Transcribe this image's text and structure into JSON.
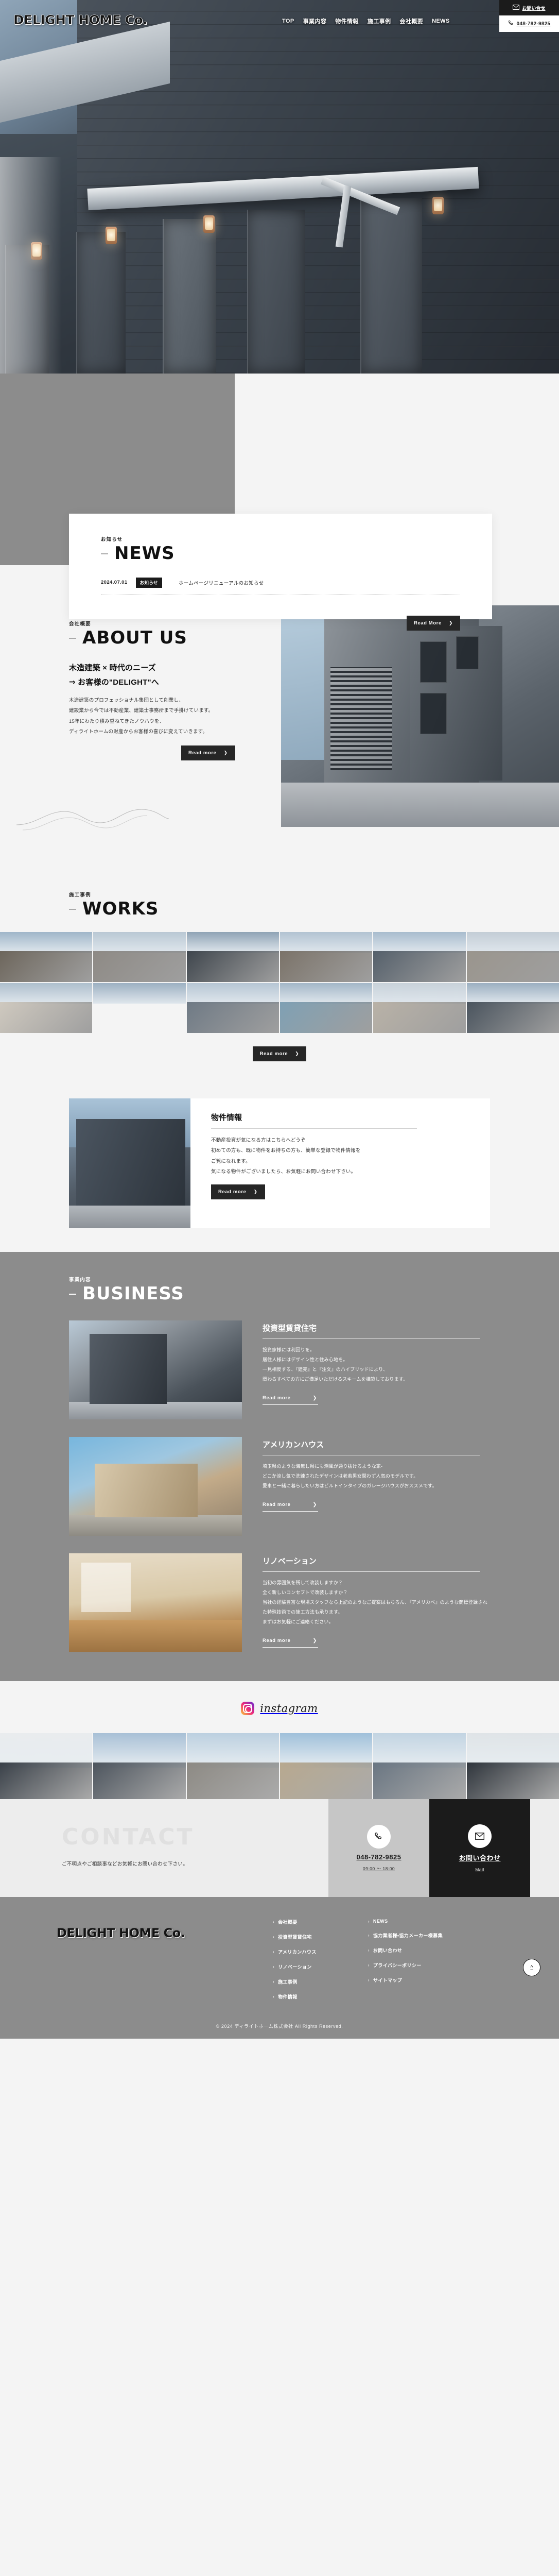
{
  "site": {
    "brand": "DELIGHT HOME Co.",
    "nav": [
      {
        "label": "TOP"
      },
      {
        "label": "事業内容"
      },
      {
        "label": "物件情報"
      },
      {
        "label": "施工事例"
      },
      {
        "label": "会社概要"
      },
      {
        "label": "NEWS"
      }
    ],
    "header_contact": {
      "mail_label": "お問い合せ",
      "mail_icon": "envelope-icon",
      "tel_label": "048-782-9825",
      "tel_icon": "phone-icon"
    }
  },
  "news": {
    "eyebrow": "お知らせ",
    "title": "NEWS",
    "items": [
      {
        "date": "2024.07.01",
        "tag": "お知らせ",
        "title": "ホームページリニューアルのお知らせ"
      }
    ],
    "button": "Read More"
  },
  "about": {
    "eyebrow": "会社概要",
    "title": "ABOUT US",
    "heading_line1": "木造建築 × 時代のニーズ",
    "heading_line2": "⇒ お客様の\"DELIGHT\"へ",
    "body": "木造建築のプロフェッショナル集団として創業し、\n建設業から今では不動産業、建築士事務所まで手掛けています。\n15年にわたり積み重ねてきたノウハウを、\nディライトホームの財産からお客様の喜びに変えていきます。",
    "button": "Read more"
  },
  "works": {
    "eyebrow": "施工事例",
    "title": "WORKS",
    "button": "Read more",
    "thumbnails": [
      {
        "sky": "#9fb6c9",
        "body": "#6d665c"
      },
      {
        "sky": "#b9c8d4",
        "body": "#8e8a85"
      },
      {
        "sky": "#8fa3b5",
        "body": "#3f464d"
      },
      {
        "sky": "#b2c3d2",
        "body": "#7b7369"
      },
      {
        "sky": "#a8bcce",
        "body": "#55606b"
      },
      {
        "sky": "#c3cdd6",
        "body": "#9a958d"
      },
      {
        "sky": "#aebfcd",
        "body": "#cfc9bf"
      },
      {
        "sky": "#9cb0c2",
        "body": "#8c8madd"
      },
      {
        "sky": "#b6c6d4",
        "body": "#6f7a85"
      },
      {
        "sky": "#a3b7c8",
        "body": "#7fa0b4"
      },
      {
        "sky": "#c8d2da",
        "body": "#b9b2a7"
      },
      {
        "sky": "#9bafc1",
        "body": "#4a545e"
      }
    ]
  },
  "property": {
    "title": "物件情報",
    "body": "不動産投資が気になる方はこちらへどうぞ\n初めての方も、既に物件をお持ちの方も、簡単な登録で物件情報を\nご覧になれます。\n気になる物件がございましたら、お気軽にお問い合わせ下さい。",
    "button": "Read more"
  },
  "business": {
    "eyebrow": "事業内容",
    "title": "BUSINESS",
    "items": [
      {
        "title": "投資型賃貸住宅",
        "body": "投資家様には利回りを。\n居住人様にはデザイン性と住み心地を。\n一見相反する、『建売』と『注文』のハイブリッドにより、\n関わるすべての方にご満足いただけるスキームを構築しております。",
        "button": "Read more"
      },
      {
        "title": "アメリカンハウス",
        "body": "埼玉県のような海無し県にも潮風が通り抜けるような家-\nどこか涼し気で洗練されたデザインは老若男女問わず人気のモデルです。\n愛車と一緒に暮らしたい方はビルトインタイプのガレージハウスがおススメです。",
        "button": "Read more"
      },
      {
        "title": "リノベーション",
        "body": "当初の雰囲気を残して改装しますか？\n全く新しいコンセプトで改装しますか？\n当社の経験豊富な現場スタッフなら上記のようなご提案はもちろん、『アメリカベ』のような商標登録された特殊技術での施工方法も承ります。\nまずはお気軽にご連絡ください。",
        "button": "Read more"
      }
    ]
  },
  "instagram": {
    "label": "instagram",
    "icon": "instagram-icon",
    "posts": [
      {
        "sky": "#e9ecee",
        "body": "#3a4149"
      },
      {
        "sky": "#a8c0d6",
        "body": "#4d555e"
      },
      {
        "sky": "#bcd0e0",
        "body": "#8d8a84"
      },
      {
        "sky": "#9fc0da",
        "body": "#b8a98f"
      },
      {
        "sky": "#c2d4e2",
        "body": "#6a7682"
      },
      {
        "sky": "#dfe4e7",
        "body": "#2f353c"
      }
    ]
  },
  "contact": {
    "title": "CONTACT",
    "subtitle": "ご不明点やご相談事などお気軽にお問い合わせ下さい。",
    "tel": {
      "icon": "phone-icon",
      "number": "048-782-9825",
      "hours": "09:00 ～ 18:00"
    },
    "mail": {
      "icon": "envelope-icon",
      "label": "お問い合わせ",
      "sub": "Mail"
    }
  },
  "footer": {
    "brand": "DELIGHT HOME Co.",
    "links_col1": [
      {
        "label": "会社概要"
      },
      {
        "label": "投資型賃貸住宅"
      },
      {
        "label": "アメリカンハウス"
      },
      {
        "label": "リノベーション"
      },
      {
        "label": "施工事例"
      },
      {
        "label": "物件情報"
      }
    ],
    "links_col2": [
      {
        "label": "NEWS"
      },
      {
        "label": "協力業者様・協力メーカー様募集"
      },
      {
        "label": "お問い合わせ"
      },
      {
        "label": "プライバシーポリシー"
      },
      {
        "label": "サイトマップ"
      }
    ],
    "to_top_icon": "chevron-up-icon",
    "copyright": "© 2024 ディライトホーム株式会社 All Rights Reserved."
  }
}
